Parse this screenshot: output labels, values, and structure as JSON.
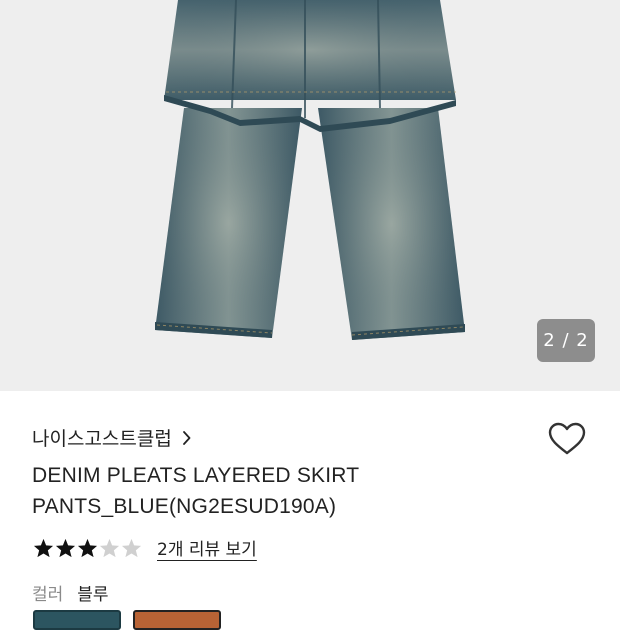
{
  "gallery": {
    "counter": "2 / 2",
    "image_alt": "denim pleats layered skirt pants"
  },
  "product": {
    "brand": "나이스고스트클럽",
    "title": "DENIM PLEATS LAYERED SKIRT PANTS_BLUE(NG2ESUD190A)",
    "rating": 3,
    "rating_max": 5,
    "review_link": "2개 리뷰 보기"
  },
  "option": {
    "label": "컬러",
    "value": "블루",
    "swatches": [
      {
        "name": "블루",
        "color": "#2c5560"
      },
      {
        "name": "브라운",
        "color": "#b86335"
      }
    ]
  },
  "colors": {
    "star_filled": "#111111",
    "star_empty": "#d0d0d0"
  },
  "icons": [
    "chevron-right-icon",
    "heart-outline-icon",
    "star-icon"
  ]
}
